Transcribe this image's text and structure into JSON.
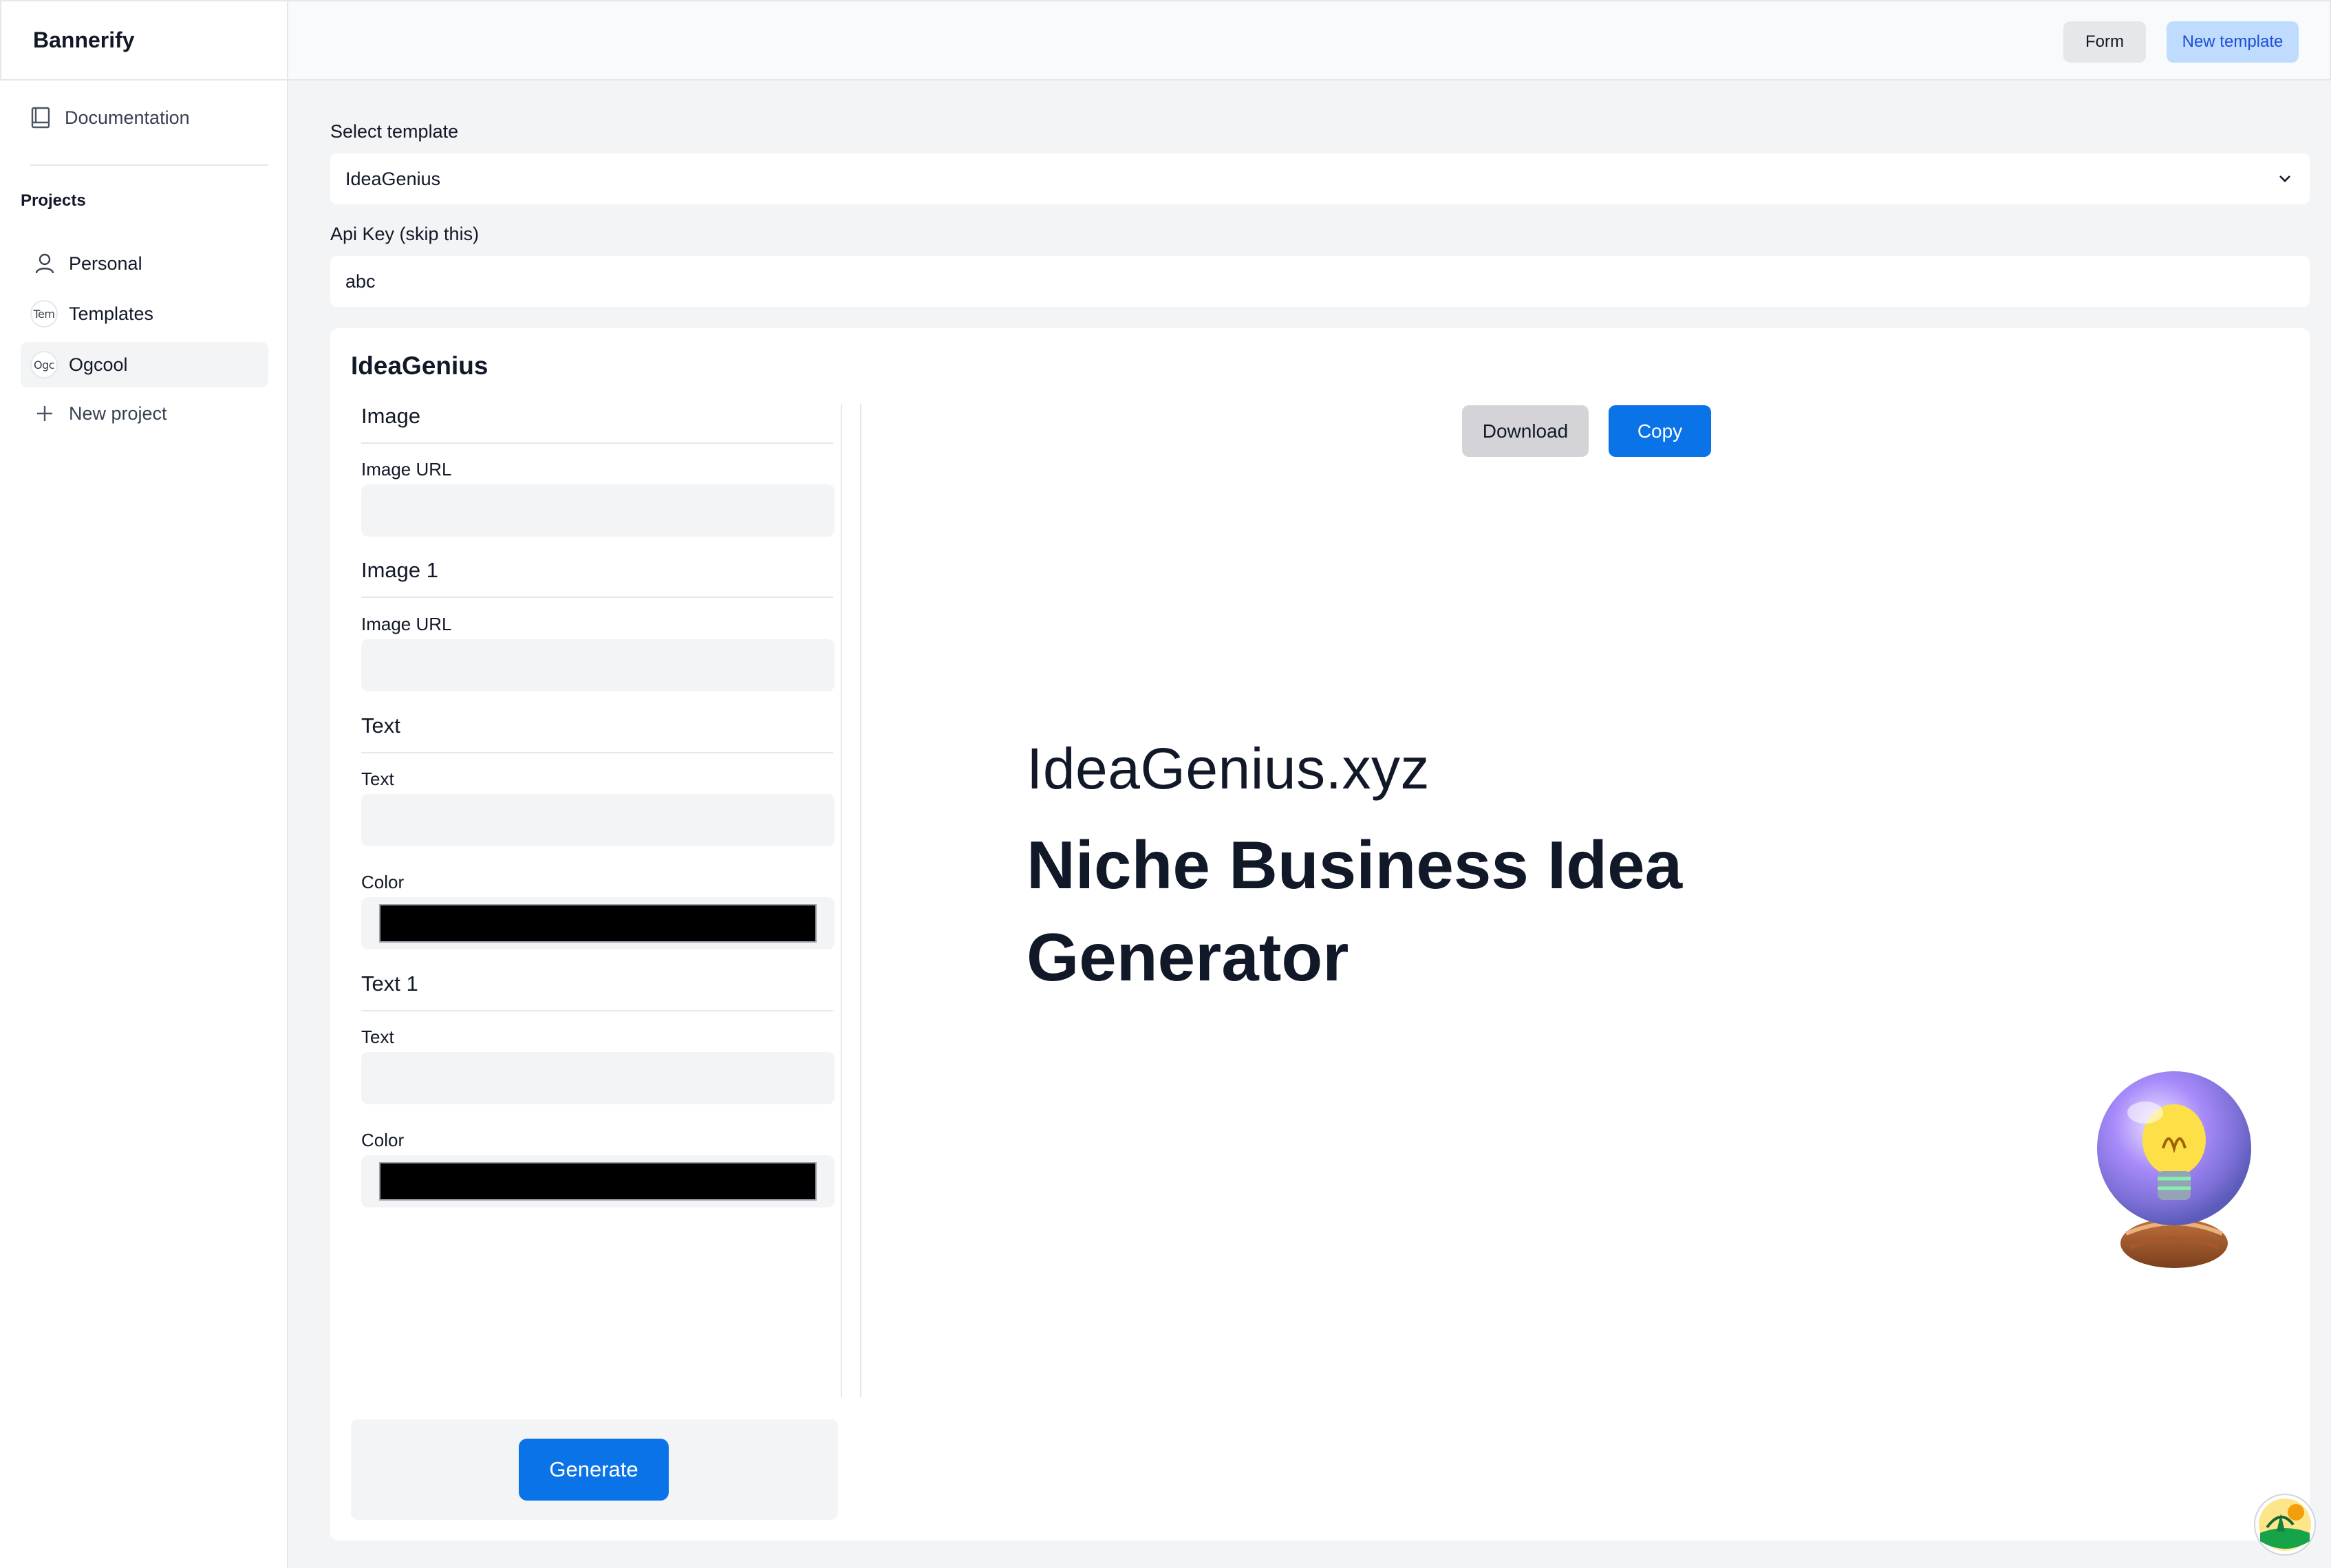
{
  "app": {
    "brand": "Bannerify"
  },
  "sidebar": {
    "documentation": "Documentation",
    "projects_heading": "Projects",
    "projects": [
      {
        "label": "Personal",
        "icon": "user-icon"
      },
      {
        "label": "Templates",
        "badge": "Tem"
      },
      {
        "label": "Ogcool",
        "badge": "Ogc",
        "active": true
      }
    ],
    "new_project": "New project"
  },
  "topbar": {
    "form": "Form",
    "new_template": "New template"
  },
  "main": {
    "select_label": "Select template",
    "select_value": "IdeaGenius",
    "api_label": "Api Key (skip this)",
    "api_value": "abc"
  },
  "card": {
    "title": "IdeaGenius",
    "sections": [
      {
        "title": "Image",
        "field_label": "Image URL"
      },
      {
        "title": "Image 1",
        "field_label": "Image URL"
      },
      {
        "title": "Text",
        "field_label": "Text",
        "color_label": "Color",
        "color": "#000000"
      },
      {
        "title": "Text 1",
        "field_label": "Text",
        "color_label": "Color",
        "color": "#000000"
      }
    ],
    "generate": "Generate",
    "download": "Download",
    "copy": "Copy"
  },
  "preview": {
    "domain": "IdeaGenius.xyz",
    "headline": "Niche Business Idea Generator"
  },
  "colors": {
    "primary": "#0b73e8",
    "accent_light": "#bfdbfe",
    "background": "#f3f4f6"
  }
}
